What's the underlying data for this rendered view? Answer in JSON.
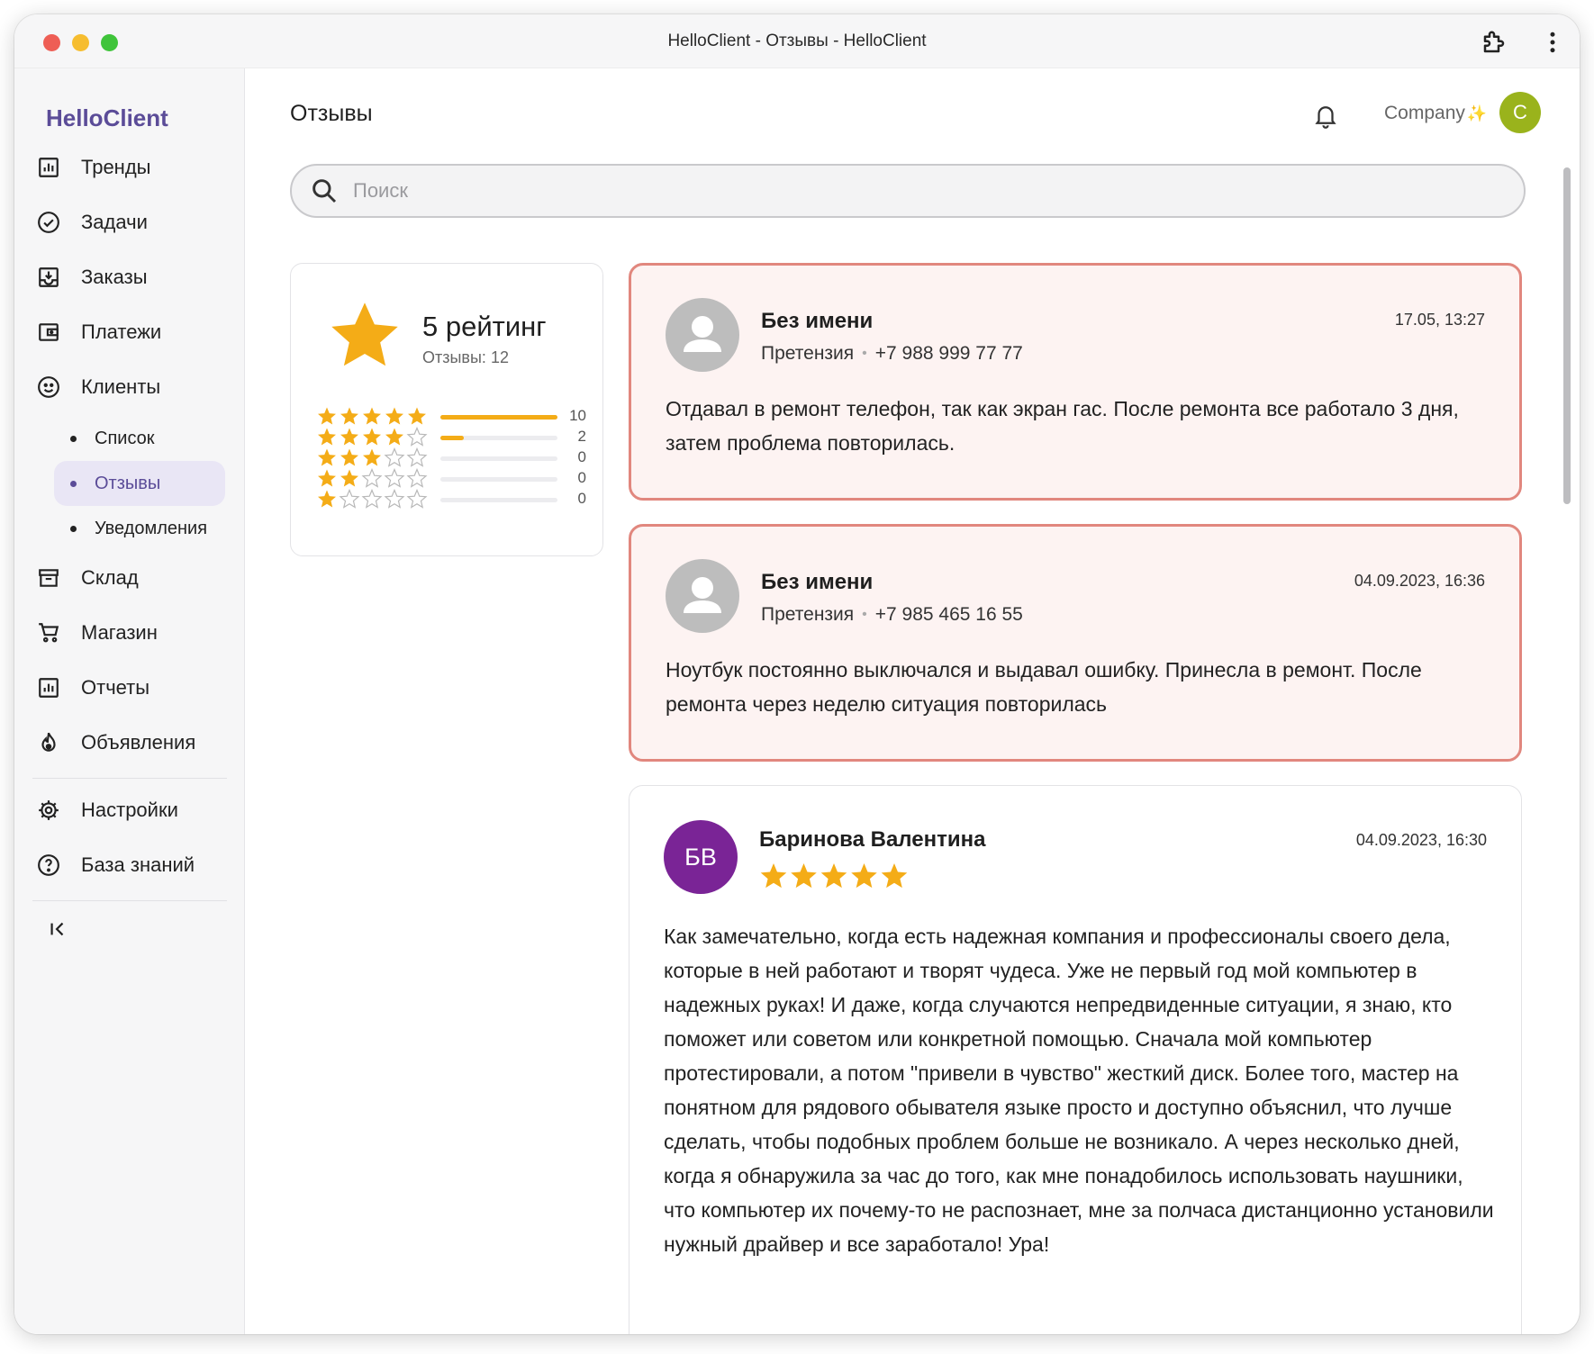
{
  "window": {
    "title": "HelloClient - Отзывы - HelloClient"
  },
  "sidebar": {
    "brand": "HelloClient",
    "items": [
      {
        "label": "Тренды",
        "icon": "bar-chart-icon"
      },
      {
        "label": "Задачи",
        "icon": "check-circle-icon"
      },
      {
        "label": "Заказы",
        "icon": "inbox-download-icon"
      },
      {
        "label": "Платежи",
        "icon": "wallet-icon"
      },
      {
        "label": "Клиенты",
        "icon": "smile-icon"
      }
    ],
    "sub_items": [
      {
        "label": "Список",
        "active": false
      },
      {
        "label": "Отзывы",
        "active": true
      },
      {
        "label": "Уведомления",
        "active": false
      }
    ],
    "items2": [
      {
        "label": "Склад",
        "icon": "archive-icon"
      },
      {
        "label": "Магазин",
        "icon": "cart-icon"
      },
      {
        "label": "Отчеты",
        "icon": "report-chart-icon"
      },
      {
        "label": "Объявления",
        "icon": "fire-icon"
      }
    ],
    "items3": [
      {
        "label": "Настройки",
        "icon": "gear-icon"
      },
      {
        "label": "База знаний",
        "icon": "help-circle-icon"
      }
    ]
  },
  "header": {
    "title": "Отзывы",
    "company": "Company",
    "avatar_initial": "C"
  },
  "search": {
    "placeholder": "Поиск"
  },
  "rating": {
    "title": "5 рейтинг",
    "count_label": "Отзывы: 12",
    "rows": [
      {
        "stars": 5,
        "count": "10",
        "fraction": 1.0
      },
      {
        "stars": 4,
        "count": "2",
        "fraction": 0.2
      },
      {
        "stars": 3,
        "count": "0",
        "fraction": 0
      },
      {
        "stars": 2,
        "count": "0",
        "fraction": 0
      },
      {
        "stars": 1,
        "count": "0",
        "fraction": 0
      }
    ]
  },
  "reviews": [
    {
      "type": "complaint",
      "name": "Без имени",
      "category": "Претензия",
      "phone": "+7 988 999 77 77",
      "date": "17.05, 13:27",
      "text": "Отдавал в ремонт телефон, так как экран гас. После ремонта все работало 3 дня, затем проблема повторилась."
    },
    {
      "type": "complaint",
      "name": "Без имени",
      "category": "Претензия",
      "phone": "+7 985 465 16 55",
      "date": "04.09.2023, 16:36",
      "text": "Ноутбук постоянно выключался и выдавал ошибку. Принесла в ремонт. После ремонта через неделю ситуация повторилась"
    },
    {
      "type": "review",
      "name": "Баринова Валентина",
      "initials": "БВ",
      "stars": 5,
      "date": "04.09.2023, 16:30",
      "text": "Как замечательно, когда есть надежная компания и профессионалы своего дела, которые в ней работают и творят чудеса. Уже не первый год мой компьютер в надежных руках! И даже, когда случаются непредвиденные ситуации, я знаю, кто поможет или советом или конкретной помощью. Сначала мой компьютер протестировали, а потом \"привели в чувство\" жесткий диск. Более того, мастер на понятном для рядового обывателя языке просто и доступно объяснил, что лучше сделать, чтобы подобных проблем больше не возникало. А через несколько дней, когда я обнаружила за час до того, как мне понадобилось использовать наушники, что компьютер их почему-то не распознает, мне за полчаса дистанционно установили нужный драйвер и все заработало! Ура!"
    }
  ],
  "colors": {
    "brand": "#5b4c98",
    "star": "#f4ac17",
    "complaint_border": "#e1877e",
    "complaint_bg": "#fdf3f2",
    "avatar_company": "#9ab31c",
    "avatar_reviewer": "#7a2496"
  }
}
